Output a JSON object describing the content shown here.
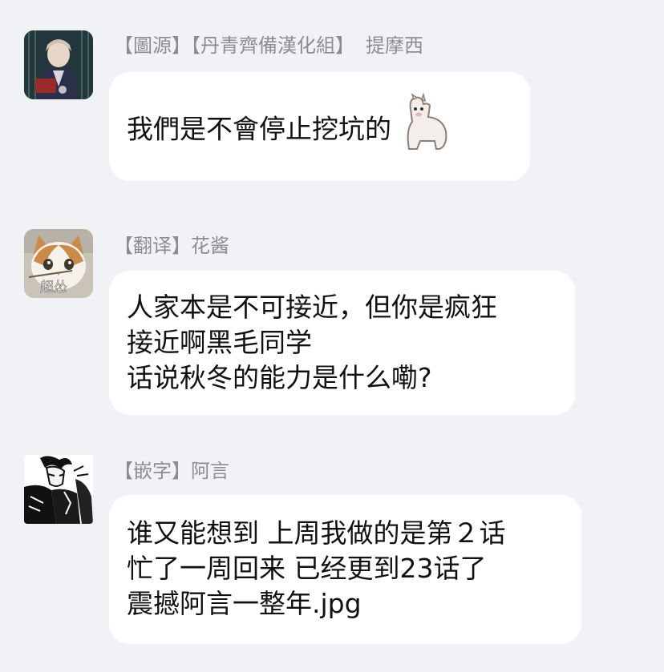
{
  "messages": [
    {
      "sender_role": "【圖源】【丹青齊備漢化組】",
      "sender_name": "提摩西",
      "avatar_icon": "anime-boy-avatar-icon",
      "lines": [
        "我們是不會停止挖坑的"
      ],
      "emoji": "alpaca-emoji-icon"
    },
    {
      "sender_role": "【翻译】",
      "sender_name": "花酱",
      "avatar_icon": "cat-avatar-icon",
      "avatar_caption": "超怂",
      "lines": [
        "人家本是不可接近，但你是疯狂",
        "接近啊黑毛同学",
        "话说秋冬的能力是什么嘞?"
      ]
    },
    {
      "sender_role": "【嵌字】",
      "sender_name": "阿言",
      "avatar_icon": "manga-character-avatar-icon",
      "lines": [
        "谁又能想到 上周我做的是第２话",
        "忙了一周回来 已经更到23话了",
        "震撼阿言一整年.jpg"
      ]
    }
  ],
  "colors": {
    "background": "#f1f2f6",
    "bubble": "#ffffff",
    "name_text": "#8c8c94",
    "message_text": "#111111"
  }
}
